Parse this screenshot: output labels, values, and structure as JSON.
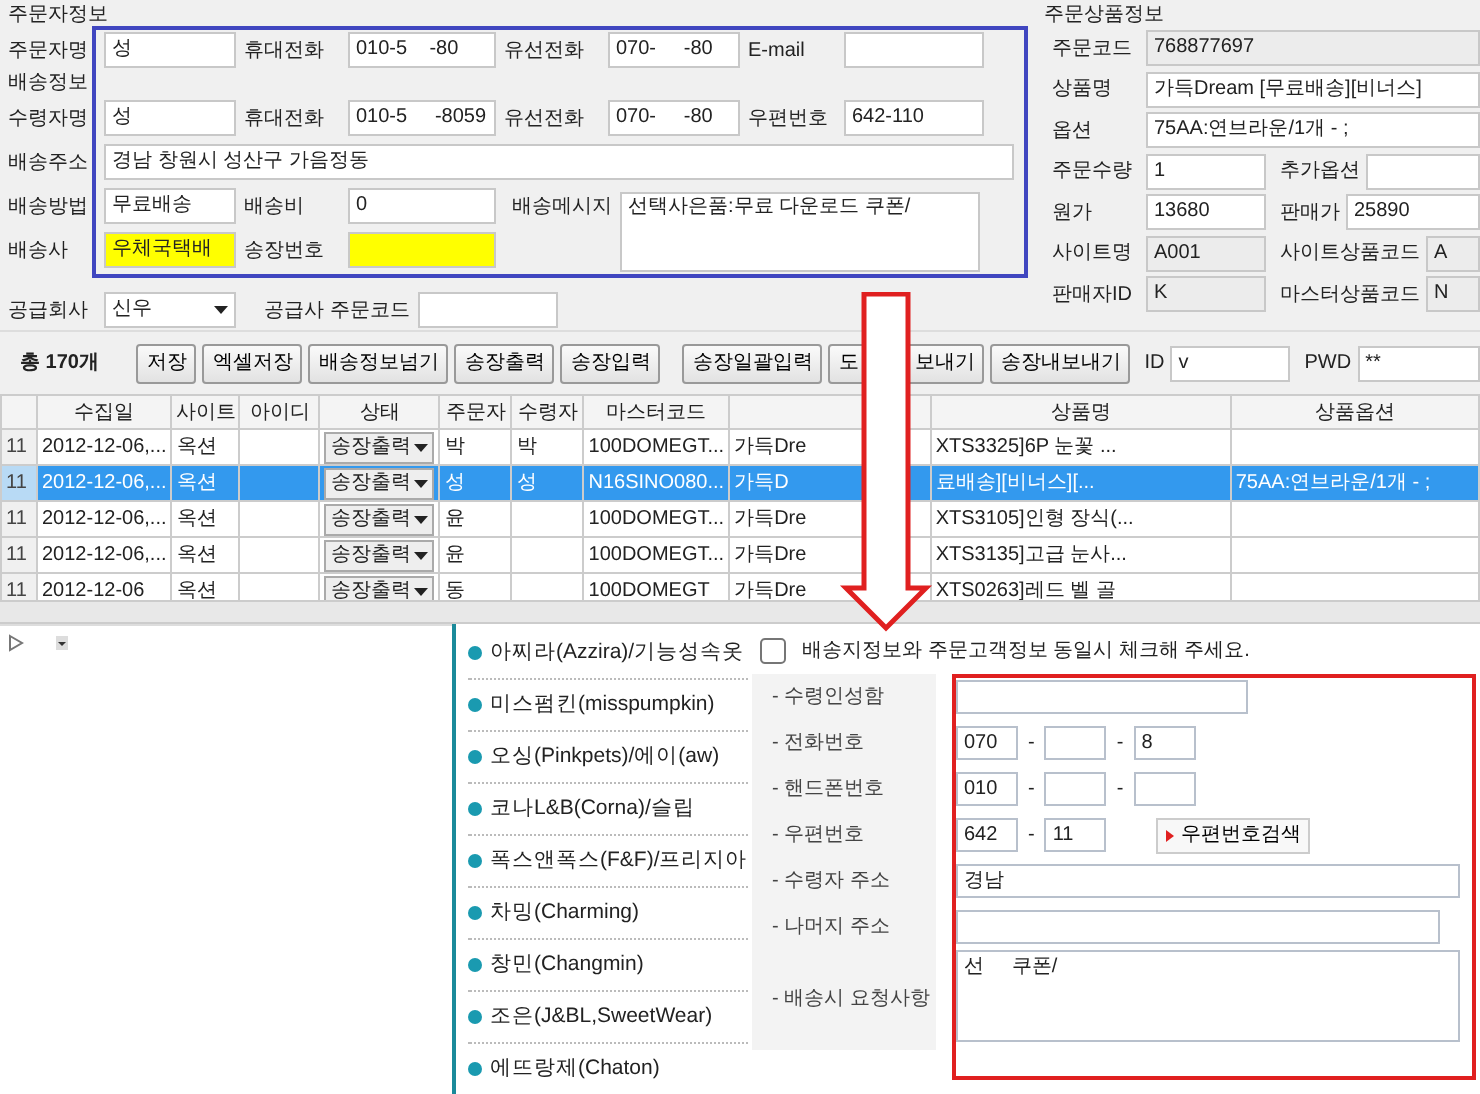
{
  "orderer": {
    "title": "주문자정보",
    "fields": [
      {
        "label": "주문자명",
        "value": "성"
      },
      {
        "label": "휴대전화",
        "value": "010-5    -80"
      },
      {
        "label": "유선전화",
        "value": "070-     -80"
      },
      {
        "label": "E-mail"
      }
    ]
  },
  "shipping": {
    "title": "배송정보",
    "recipient": [
      {
        "label": "수령자명",
        "value": "성"
      },
      {
        "label": "휴대전화",
        "value": "010-5     -8059"
      },
      {
        "label": "유선전화",
        "value": "070-     -80"
      },
      {
        "label": "우편번호",
        "value": "642-110"
      }
    ],
    "address": {
      "label": "배송주소",
      "value": "경남 창원시 성산구 가음정동"
    },
    "method_rows": [
      [
        {
          "label": "배송방법",
          "value": "무료배송",
          "highlighted": false
        },
        {
          "label": "배송비",
          "value": "0",
          "highlighted": false
        }
      ],
      [
        {
          "label": "배송사",
          "value": "우체국택배",
          "highlighted": true
        },
        {
          "label": "송장번호",
          "highlighted": true
        }
      ]
    ],
    "message": {
      "label": "배송메시지",
      "value": "선택사은품:무료 다운로드 쿠폰/"
    }
  },
  "supplier": {
    "label": "공급회사",
    "value": "신우",
    "code_label": "공급사 주문코드"
  },
  "product": {
    "title": "주문상품정보",
    "rows": [
      [
        {
          "label": "주문코드",
          "value": "768877697",
          "readonly": true
        }
      ],
      [
        {
          "label": "상품명",
          "value": "가득Dream [무료배송][비너스]",
          "readonly": false
        }
      ],
      [
        {
          "label": "옵션",
          "value": "75AA:연브라운/1개 - ;",
          "readonly": false
        }
      ],
      [
        {
          "label": "주문수량",
          "value": "1",
          "readonly": false
        },
        {
          "label": "추가옵션",
          "readonly": false
        }
      ],
      [
        {
          "label": "원가",
          "value": "13680",
          "readonly": false
        },
        {
          "label": "판매가",
          "value": "25890",
          "readonly": false
        }
      ],
      [
        {
          "label": "사이트명",
          "value": "A001",
          "readonly": true
        },
        {
          "label": "사이트상품코드",
          "value": "A",
          "readonly": true
        }
      ],
      [
        {
          "label": "판매자ID",
          "value": "K",
          "readonly": true
        },
        {
          "label": "마스터상품코드",
          "value": "N",
          "readonly": true
        }
      ]
    ]
  },
  "toolbar": {
    "total": "총 170개",
    "buttons": [
      "저장",
      "엑셀저장",
      "배송정보넘기",
      "송장출력",
      "송장입력",
      "송장일괄입력",
      "도          보내기",
      "송장내보내기"
    ],
    "id_label": "ID",
    "id_value": "v",
    "pwd_label": "PWD",
    "pwd_value": "**"
  },
  "table": {
    "columns": [
      {
        "label": "수집일"
      },
      {
        "label": "사이트"
      },
      {
        "label": "아이디"
      },
      {
        "label": "상태"
      },
      {
        "label": "주문자"
      },
      {
        "label": "수령자"
      },
      {
        "label": "마스터코드"
      },
      {},
      {
        "label": "상품명"
      },
      {
        "label": "상품옵션"
      }
    ],
    "rows": [
      {
        "row_header": "11",
        "selected": false,
        "cells": [
          "2012-12-06,...",
          "옥션",
          "",
          "송장출력",
          "박",
          "박",
          "100DOMEGT...",
          "가득Dre",
          "XTS3325]6P 눈꽃 ...",
          ""
        ]
      },
      {
        "row_header": "11",
        "selected": true,
        "cells": [
          "2012-12-06,...",
          "옥션",
          "",
          "송장출력",
          "성",
          "성",
          "N16SINO080...",
          "가득D",
          "료배송][비너스][...",
          "75AA:연브라운/1개 - ;"
        ]
      },
      {
        "row_header": "11",
        "selected": false,
        "cells": [
          "2012-12-06,...",
          "옥션",
          "",
          "송장출력",
          "윤",
          "",
          "100DOMEGT...",
          "가득Dre",
          "XTS3105]인형 장식(...",
          ""
        ]
      },
      {
        "row_header": "11",
        "selected": false,
        "cells": [
          "2012-12-06,...",
          "옥션",
          "",
          "송장출력",
          "윤",
          "",
          "100DOMEGT...",
          "가득Dre",
          "XTS3135]고급 눈사...",
          ""
        ]
      },
      {
        "row_header": "11",
        "selected": false,
        "cells": [
          "2012-12-06",
          "옥션",
          "",
          "송장출력",
          "동",
          "",
          "100DOMEGT",
          "가득Dre",
          "XTS0263]레드 벨 골",
          ""
        ]
      }
    ]
  },
  "brands": [
    "아찌라(Azzira)/기능성속옷",
    "미스펌킨(misspumpkin)",
    "오싱(Pinkpets)/에이(aw)",
    "코나L&B(Corna)/슬립",
    "폭스앤폭스(F&F)/프리지아",
    "차밍(Charming)",
    "창민(Changmin)",
    "조은(J&BL,SweetWear)",
    "에뜨랑제(Chaton)"
  ],
  "delivery_form": {
    "same_info": {
      "label": "배송지정보와 주문고객정보 동일시 체크해 주세요.",
      "checked": false
    },
    "rows": [
      {
        "kind": "text",
        "label": "- 수령인성함"
      },
      {
        "kind": "phone",
        "label": "- 전화번호",
        "part1": "070",
        "part3": "8",
        "separator": "-"
      },
      {
        "kind": "phone",
        "label": "- 핸드폰번호",
        "part1": "010",
        "separator": "-"
      },
      {
        "kind": "zip",
        "label": "- 우편번호",
        "part1": "642",
        "part2": "11",
        "separator": "-",
        "button": "우편번호검색"
      },
      {
        "kind": "wide",
        "label": "- 수령자 주소",
        "part1": "경남"
      },
      {
        "kind": "text2",
        "label": "- 나머지 주소"
      },
      {
        "kind": "area",
        "label": "- 배송시 요청사항",
        "part1": "선     쿠폰/"
      }
    ]
  }
}
